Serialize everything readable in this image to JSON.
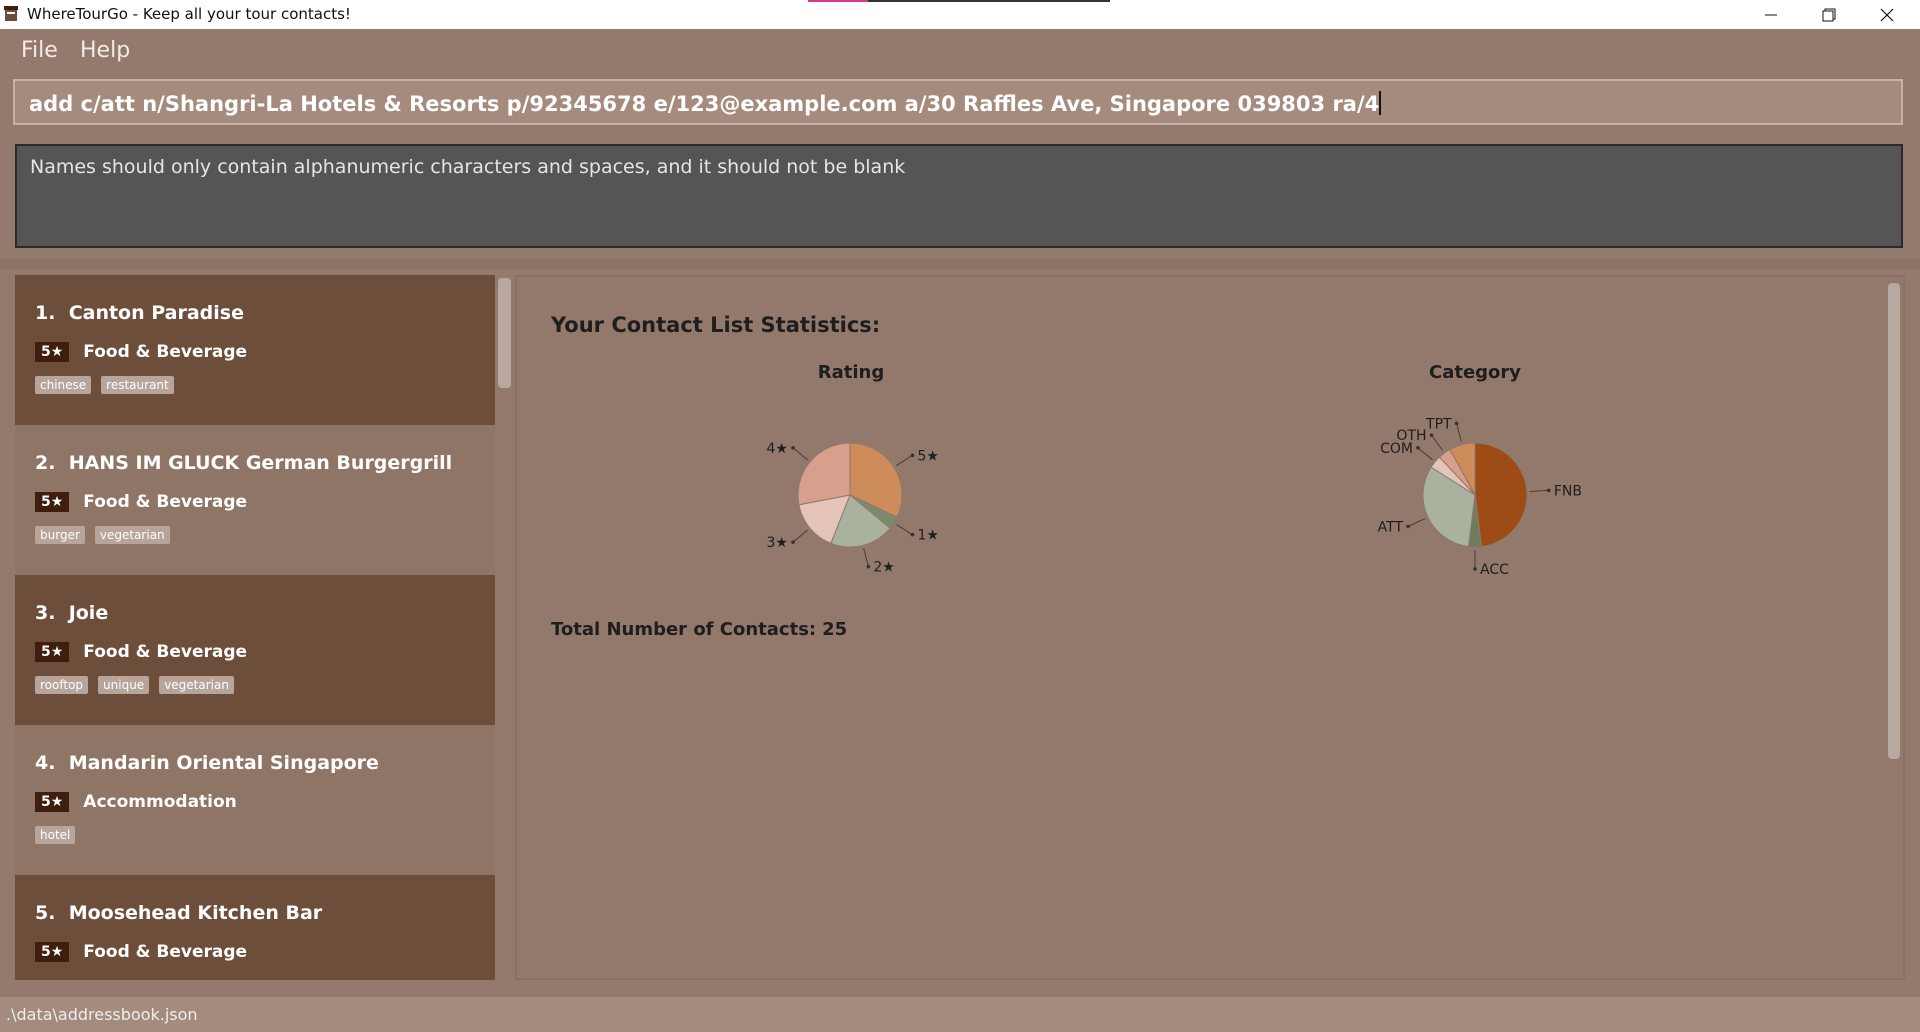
{
  "window": {
    "title": "WhereTourGo - Keep all your tour contacts!"
  },
  "menu": {
    "file": "File",
    "help": "Help"
  },
  "command": {
    "value": "add c/att n/Shangri-La Hotels & Resorts p/92345678 e/123@example.com a/30 Raffles Ave, Singapore 039803 ra/4"
  },
  "result": {
    "message": "Names should only contain alphanumeric characters and spaces, and it should not be blank"
  },
  "contacts": [
    {
      "index": "1.",
      "name": "Canton Paradise",
      "rating": "5★",
      "category": "Food & Beverage",
      "tags": [
        "chinese",
        "restaurant"
      ]
    },
    {
      "index": "2.",
      "name": "HANS IM GLUCK German Burgergrill",
      "rating": "5★",
      "category": "Food & Beverage",
      "tags": [
        "burger",
        "vegetarian"
      ]
    },
    {
      "index": "3.",
      "name": "Joie",
      "rating": "5★",
      "category": "Food & Beverage",
      "tags": [
        "rooftop",
        "unique",
        "vegetarian"
      ]
    },
    {
      "index": "4.",
      "name": "Mandarin Oriental Singapore",
      "rating": "5★",
      "category": "Accommodation",
      "tags": [
        "hotel"
      ]
    },
    {
      "index": "5.",
      "name": "Moosehead Kitchen Bar",
      "rating": "5★",
      "category": "Food & Beverage",
      "tags": []
    }
  ],
  "stats": {
    "title": "Your Contact List Statistics:",
    "total_label": "Total Number of Contacts:",
    "total_value": "25"
  },
  "chart_data": [
    {
      "type": "pie",
      "title": "Rating",
      "labels": [
        "5★",
        "1★",
        "2★",
        "3★",
        "4★"
      ],
      "values": [
        8,
        1,
        5,
        4,
        7
      ],
      "colors": [
        "#cd8c5a",
        "#7b8a6c",
        "#a8b29f",
        "#e4c4b8",
        "#d8a08c"
      ]
    },
    {
      "type": "pie",
      "title": "Category",
      "labels": [
        "FNB",
        "ACC",
        "ATT",
        "COM",
        "OTH",
        "TPT"
      ],
      "values": [
        12,
        1,
        8,
        1,
        1,
        2
      ],
      "colors": [
        "#9c4c14",
        "#6f7c5e",
        "#a8b29f",
        "#e4c4b8",
        "#d8a08c",
        "#cd8c5a"
      ]
    }
  ],
  "statusbar": {
    "path": ".\\data\\addressbook.json"
  }
}
